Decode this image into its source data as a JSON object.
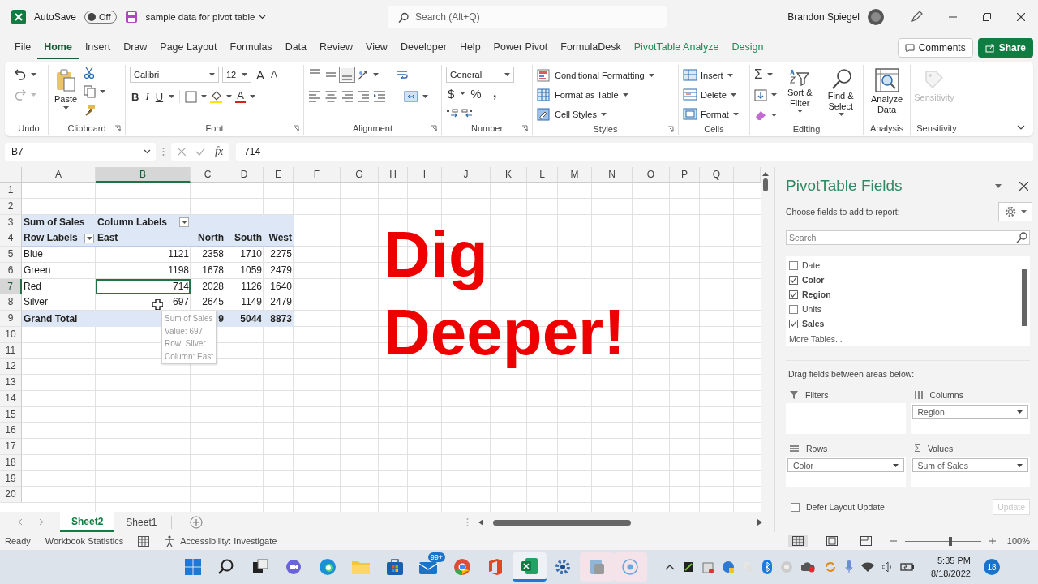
{
  "title_bar": {
    "autosave_label": "AutoSave",
    "autosave": {
      "on": false,
      "label": "Off"
    },
    "file_name": "sample data for pivot table",
    "search": {
      "placeholder": "Search (Alt+Q)"
    },
    "user_name": "Brandon Spiegel"
  },
  "menu_tabs": [
    {
      "label": "File",
      "selected": false,
      "kind": "standard"
    },
    {
      "label": "Home",
      "selected": true,
      "kind": "standard"
    },
    {
      "label": "Insert",
      "selected": false,
      "kind": "standard"
    },
    {
      "label": "Draw",
      "selected": false,
      "kind": "standard"
    },
    {
      "label": "Page Layout",
      "selected": false,
      "kind": "standard"
    },
    {
      "label": "Formulas",
      "selected": false,
      "kind": "standard"
    },
    {
      "label": "Data",
      "selected": false,
      "kind": "standard"
    },
    {
      "label": "Review",
      "selected": false,
      "kind": "standard"
    },
    {
      "label": "View",
      "selected": false,
      "kind": "standard"
    },
    {
      "label": "Developer",
      "selected": false,
      "kind": "standard"
    },
    {
      "label": "Help",
      "selected": false,
      "kind": "standard"
    },
    {
      "label": "Power Pivot",
      "selected": false,
      "kind": "standard"
    },
    {
      "label": "FormulaDesk",
      "selected": false,
      "kind": "standard"
    },
    {
      "label": "PivotTable Analyze",
      "selected": false,
      "kind": "contextual"
    },
    {
      "label": "Design",
      "selected": false,
      "kind": "contextual"
    }
  ],
  "comments_button": "Comments",
  "share_button": "Share",
  "ribbon": {
    "groups": [
      {
        "kind": "undo",
        "label": "Undo"
      },
      {
        "kind": "clipboard",
        "label": "Clipboard",
        "paste": "Paste"
      },
      {
        "kind": "font",
        "label": "Font",
        "font_name": "Calibri",
        "font_size": "12",
        "grow": "A",
        "shrink": "A",
        "bold": "B",
        "italic": "I",
        "underline": "U",
        "font_color": "A"
      },
      {
        "kind": "alignment",
        "label": "Alignment"
      },
      {
        "kind": "number",
        "label": "Number",
        "format": "General",
        "currency": "$",
        "percent": "%",
        "comma": ","
      },
      {
        "kind": "styles",
        "label": "Styles",
        "items": [
          "Conditional Formatting",
          "Format as Table",
          "Cell Styles"
        ]
      },
      {
        "kind": "cells",
        "label": "Cells",
        "items": [
          "Insert",
          "Delete",
          "Format"
        ]
      },
      {
        "kind": "editing",
        "label": "Editing",
        "autosum": "Σ",
        "sort": "Sort & Filter",
        "find": "Find & Select"
      },
      {
        "kind": "analysis",
        "label": "Analysis",
        "button": "Analyze Data"
      },
      {
        "kind": "sensitivity",
        "label": "Sensitivity",
        "button": "Sensitivity",
        "disabled": true
      }
    ]
  },
  "formula_bar": {
    "name_box": "B7",
    "function_label": "fx",
    "value": "714"
  },
  "sheet": {
    "columns": [
      {
        "label": "A",
        "selected": false
      },
      {
        "label": "B",
        "selected": true
      },
      {
        "label": "C",
        "selected": false
      },
      {
        "label": "D",
        "selected": false
      },
      {
        "label": "E",
        "selected": false
      },
      {
        "label": "F",
        "selected": false
      },
      {
        "label": "G",
        "selected": false
      },
      {
        "label": "H",
        "selected": false
      },
      {
        "label": "I",
        "selected": false
      },
      {
        "label": "J",
        "selected": false
      },
      {
        "label": "K",
        "selected": false
      },
      {
        "label": "L",
        "selected": false
      },
      {
        "label": "M",
        "selected": false
      },
      {
        "label": "N",
        "selected": false
      },
      {
        "label": "O",
        "selected": false
      },
      {
        "label": "P",
        "selected": false
      },
      {
        "label": "Q",
        "selected": false
      }
    ],
    "rows": [
      {
        "label": "1",
        "selected": false
      },
      {
        "label": "2",
        "selected": false
      },
      {
        "label": "3",
        "selected": false
      },
      {
        "label": "4",
        "selected": false
      },
      {
        "label": "5",
        "selected": false
      },
      {
        "label": "6",
        "selected": false
      },
      {
        "label": "7",
        "selected": true
      },
      {
        "label": "8",
        "selected": false
      },
      {
        "label": "9",
        "selected": false
      },
      {
        "label": "10",
        "selected": false
      },
      {
        "label": "11",
        "selected": false
      },
      {
        "label": "12",
        "selected": false
      },
      {
        "label": "13",
        "selected": false
      },
      {
        "label": "14",
        "selected": false
      },
      {
        "label": "15",
        "selected": false
      },
      {
        "label": "16",
        "selected": false
      },
      {
        "label": "17",
        "selected": false
      },
      {
        "label": "18",
        "selected": false
      },
      {
        "label": "19",
        "selected": false
      },
      {
        "label": "20",
        "selected": false
      }
    ],
    "pivot": {
      "corner": "Sum of Sales",
      "column_labels": "Column Labels",
      "row_labels": "Row Labels",
      "regions": [
        "East",
        "North",
        "South",
        "West"
      ],
      "rows": [
        {
          "label": "Blue",
          "values": [
            "1121",
            "2358",
            "1710",
            "2275"
          ]
        },
        {
          "label": "Green",
          "values": [
            "1198",
            "1678",
            "1059",
            "2479"
          ]
        },
        {
          "label": "Red",
          "values": [
            "714",
            "2028",
            "1126",
            "1640"
          ]
        },
        {
          "label": "Silver",
          "values": [
            "697",
            "2645",
            "1149",
            "2479"
          ]
        }
      ],
      "grand_total": {
        "label": "Grand Total",
        "values": [
          "9",
          "5044",
          "8873"
        ]
      }
    },
    "tooltip": [
      "Sum of Sales",
      "Value: 697",
      "Row: Silver",
      "Column: East"
    ]
  },
  "overlay_text": "Dig Deeper!",
  "sheet_tabs": [
    {
      "label": "Sheet2",
      "selected": true
    },
    {
      "label": "Sheet1",
      "selected": false
    }
  ],
  "pivot_pane": {
    "title": "PivotTable Fields",
    "subtitle": "Choose fields to add to report:",
    "search_placeholder": "Search",
    "fields": [
      {
        "label": "Date",
        "checked": false
      },
      {
        "label": "Color",
        "checked": true
      },
      {
        "label": "Region",
        "checked": true
      },
      {
        "label": "Units",
        "checked": false
      },
      {
        "label": "Sales",
        "checked": true
      }
    ],
    "more_tables": "More Tables...",
    "drag_hint": "Drag fields between areas below:",
    "areas": [
      {
        "kind": "filters",
        "label": "Filters"
      },
      {
        "kind": "columns",
        "label": "Columns",
        "items": [
          "Region"
        ]
      },
      {
        "kind": "rows",
        "label": "Rows",
        "items": [
          "Color"
        ]
      },
      {
        "kind": "values",
        "label": "Values",
        "symbol": "Σ",
        "items": [
          "Sum of Sales"
        ]
      }
    ],
    "defer": {
      "label": "Defer Layout Update",
      "checked": false
    },
    "update_button": {
      "label": "Update",
      "disabled": true
    }
  },
  "status_bar": {
    "mode": "Ready",
    "statistics": "Workbook Statistics",
    "accessibility": "Accessibility: Investigate",
    "zoom": {
      "level": 0.6,
      "reading": "100%"
    }
  },
  "taskbar": {
    "mail_badge": "99+",
    "time": "5:35 PM",
    "date": "8/18/2022",
    "notification_count": "18"
  }
}
